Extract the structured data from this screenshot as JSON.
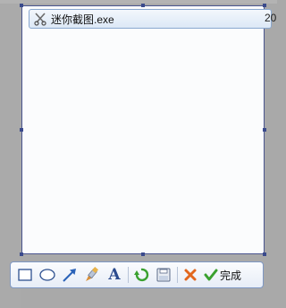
{
  "taskbar_item": {
    "label": "迷你截图.exe",
    "overflow_text": "20",
    "icon": "scissors-icon"
  },
  "toolbar": {
    "tools": [
      {
        "name": "rectangle-tool",
        "icon": "rectangle-icon"
      },
      {
        "name": "ellipse-tool",
        "icon": "ellipse-icon"
      },
      {
        "name": "arrow-tool",
        "icon": "arrow-icon"
      },
      {
        "name": "brush-tool",
        "icon": "brush-icon"
      },
      {
        "name": "text-tool",
        "icon": "text-icon",
        "glyph": "A"
      }
    ],
    "actions": [
      {
        "name": "undo-button",
        "icon": "undo-icon"
      },
      {
        "name": "save-button",
        "icon": "save-icon"
      }
    ],
    "cancel": {
      "name": "cancel-button",
      "icon": "close-icon"
    },
    "done": {
      "name": "done-button",
      "icon": "checkmark-icon",
      "label": "完成"
    }
  },
  "colors": {
    "background_dim": "#a9a9a9",
    "selection_border": "#49548e",
    "toolbar_border": "#7f98c4",
    "accent_blue": "#2b63b8",
    "cancel_orange": "#e2671e",
    "done_green": "#3aa12f"
  }
}
